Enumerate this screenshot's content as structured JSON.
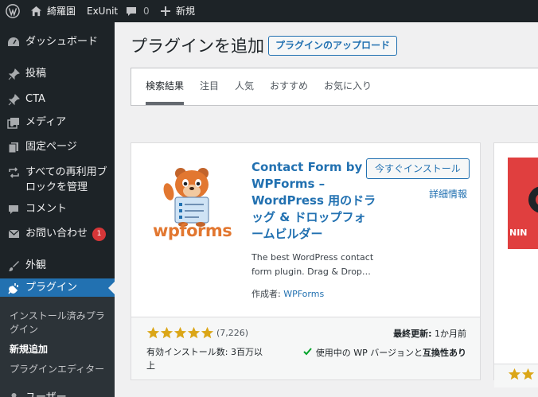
{
  "admin_bar": {
    "site_name": "綺羅園",
    "theme_link": "ExUnit",
    "comments_count": "0",
    "new_label": "新規"
  },
  "sidebar": {
    "items": [
      {
        "label": "ダッシュボード",
        "icon": "dashboard-icon"
      },
      {
        "label": "投稿",
        "icon": "pin-icon"
      },
      {
        "label": "CTA",
        "icon": "pin-icon"
      },
      {
        "label": "メディア",
        "icon": "media-icon"
      },
      {
        "label": "固定ページ",
        "icon": "page-icon"
      },
      {
        "label": "すべての再利用ブロックを管理",
        "label_line1": "すべての再利用ブ",
        "label_line2": "ロックを管理",
        "icon": "reusable-block-icon"
      },
      {
        "label": "コメント",
        "icon": "comment-icon"
      },
      {
        "label": "お問い合わせ",
        "icon": "mail-icon",
        "badge": "1"
      },
      {
        "label": "外観",
        "icon": "appearance-icon"
      },
      {
        "label": "プラグイン",
        "icon": "plugin-icon",
        "current": true
      },
      {
        "label": "ユーザー",
        "icon": "user-icon"
      }
    ],
    "submenu": [
      {
        "label_line1": "インストール済みプラ",
        "label_line2": "グイン"
      },
      {
        "label": "新規追加",
        "active": true
      },
      {
        "label": "プラグインエディター"
      }
    ]
  },
  "page": {
    "title": "プラグインを追加",
    "upload_button": "プラグインのアップロード"
  },
  "filter_tabs": [
    "検索結果",
    "注目",
    "人気",
    "おすすめ",
    "お気に入り"
  ],
  "plugin_card": {
    "name_lines": [
      "Contact Form by",
      "WPForms –",
      "WordPress 用のドラ",
      "ッグ & ドロップフォ",
      "ームビルダー"
    ],
    "install_button": "今すぐインストール",
    "more_details": "詳細情報",
    "description_lines": [
      "The best WordPress contact",
      "form plugin. Drag & Drop…"
    ],
    "author_label": "作成者:",
    "author_name": "WPForms",
    "rating_stars": 5,
    "rating_count": "(7,226)",
    "active_installs_lines": [
      "有効インストール数: 3百万以",
      "上"
    ],
    "last_updated_label": "最終更新:",
    "last_updated_value": "1か月前",
    "compat_prefix": "使用中の WP バージョンと",
    "compat_status": "互換性あり",
    "logo_text": "wpforms"
  },
  "second_card": {
    "logo_text": "NIN"
  },
  "colors": {
    "admin_dark": "#1d2327",
    "accent_blue": "#2271b1",
    "star_yellow": "#dba617",
    "badge_red": "#d63638",
    "compat_green": "#00a32a",
    "wpforms_orange": "#e27730"
  }
}
